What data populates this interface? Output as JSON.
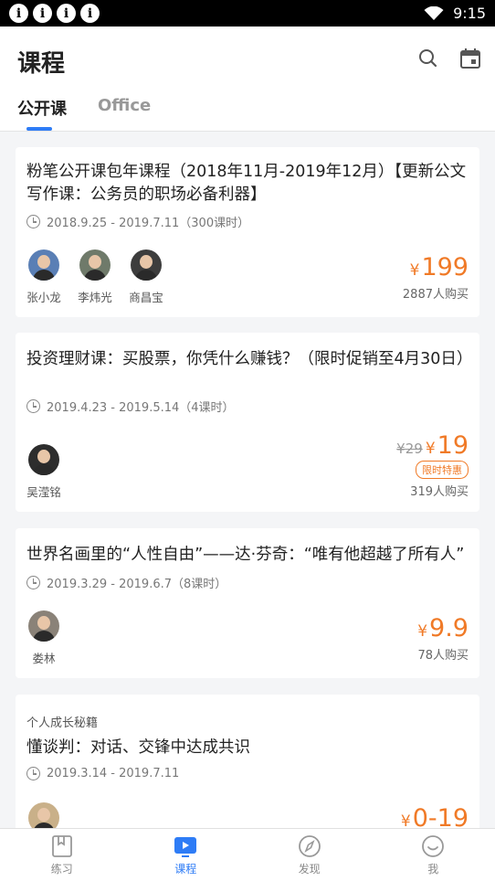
{
  "status_bar": {
    "time": "9:15",
    "notification_icons": [
      "i",
      "i",
      "i",
      "i"
    ]
  },
  "header": {
    "title": "课程",
    "tabs": [
      {
        "label": "公开课",
        "active": true
      },
      {
        "label": "Office",
        "active": false
      }
    ]
  },
  "colors": {
    "accent": "#2e7cf6",
    "price": "#f07a27"
  },
  "courses": [
    {
      "title": "粉笔公开课包年课程（2018年11月-2019年12月）【更新公文写作课：公务员的职场必备利器】",
      "date": "2018.9.25 - 2019.7.11（300课时）",
      "teachers": [
        "张小龙",
        "李炜光",
        "商昌宝"
      ],
      "price_symbol": "¥",
      "price": "199",
      "buyers": "2887人购买"
    },
    {
      "title": "投资理财课：买股票，你凭什么赚钱？（限时促销至4月30日）",
      "date": "2019.4.23 - 2019.5.14（4课时）",
      "teachers": [
        "吴滢铭"
      ],
      "original_price": "¥29",
      "price_symbol": "¥",
      "price": "19",
      "promo": "限时特惠",
      "buyers": "319人购买"
    },
    {
      "title": "世界名画里的“人性自由”——达·芬奇：“唯有他超越了所有人”",
      "date": "2019.3.29 - 2019.6.7（8课时）",
      "teachers": [
        "娄林"
      ],
      "price_symbol": "¥",
      "price": "9.9",
      "buyers": "78人购买"
    },
    {
      "category": "个人成长秘籍",
      "title": "懂谈判：对话、交锋中达成共识",
      "date": "2019.3.14 - 2019.7.11",
      "price_symbol": "¥",
      "price": "0-19"
    }
  ],
  "bottom_nav": [
    {
      "label": "练习",
      "icon": "practice-icon"
    },
    {
      "label": "课程",
      "icon": "course-play-icon",
      "active": true
    },
    {
      "label": "发现",
      "icon": "compass-icon"
    },
    {
      "label": "我",
      "icon": "profile-icon"
    }
  ]
}
